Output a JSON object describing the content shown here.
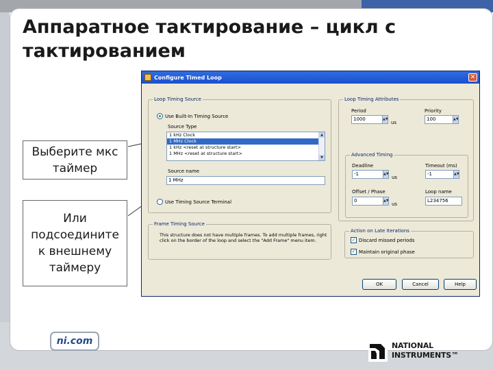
{
  "slide": {
    "title": "Аппаратное тактирование – цикл с тактированием",
    "site_badge": "ni.com",
    "logo_line1": "NATIONAL",
    "logo_line2": "INSTRUMENTS™"
  },
  "callouts": [
    {
      "text": "Выберите мкс таймер"
    },
    {
      "text": "Или подсоедините к внешнему таймеру"
    }
  ],
  "dialog": {
    "title": "Configure Timed Loop",
    "loop_timing_source": {
      "group_title": "Loop Timing Source",
      "builtin_radio_label": "Use Built-In Timing Source",
      "source_type_label": "Source Type",
      "source_type_items": [
        "1 kHz Clock",
        "1 MHz Clock",
        "1 kHz <reset at structure start>",
        "1 MHz <reset at structure start>"
      ],
      "selected_index": 1,
      "source_name_label": "Source name",
      "source_name_value": "1 MHz",
      "terminal_radio_label": "Use Timing Source Terminal"
    },
    "frame_timing_source": {
      "group_title": "Frame Timing Source",
      "description": "This structure does not have multiple frames. To add multiple frames, right click on the border of the loop and select the \"Add Frame\" menu item."
    },
    "loop_timing_attributes": {
      "group_title": "Loop Timing Attributes",
      "period_label": "Period",
      "period_value": "1000",
      "period_unit": "us",
      "priority_label": "Priority",
      "priority_value": "100"
    },
    "advanced_timing": {
      "group_title": "Advanced Timing",
      "deadline_label": "Deadline",
      "deadline_value": "-1",
      "deadline_unit": "us",
      "timeout_label": "Timeout (ms)",
      "timeout_value": "-1",
      "offset_label": "Offset / Phase",
      "offset_value": "0",
      "offset_unit": "us",
      "loop_name_label": "Loop name",
      "loop_name_value": "L234756"
    },
    "late_iterations": {
      "group_title": "Action on Late Iterations",
      "discard_label": "Discard missed periods",
      "maintain_label": "Maintain original phase"
    },
    "buttons": {
      "ok": "OK",
      "cancel": "Cancel",
      "help": "Help"
    },
    "icons": {
      "close": "✕",
      "spin": "▲▼",
      "scroll_up": "▲",
      "scroll_down": "▼",
      "check": "✓"
    }
  },
  "colors": {
    "accent_blue": "#3d62a8",
    "titlebar_blue": "#1a4fcf",
    "dialog_bg": "#ece9d8"
  }
}
